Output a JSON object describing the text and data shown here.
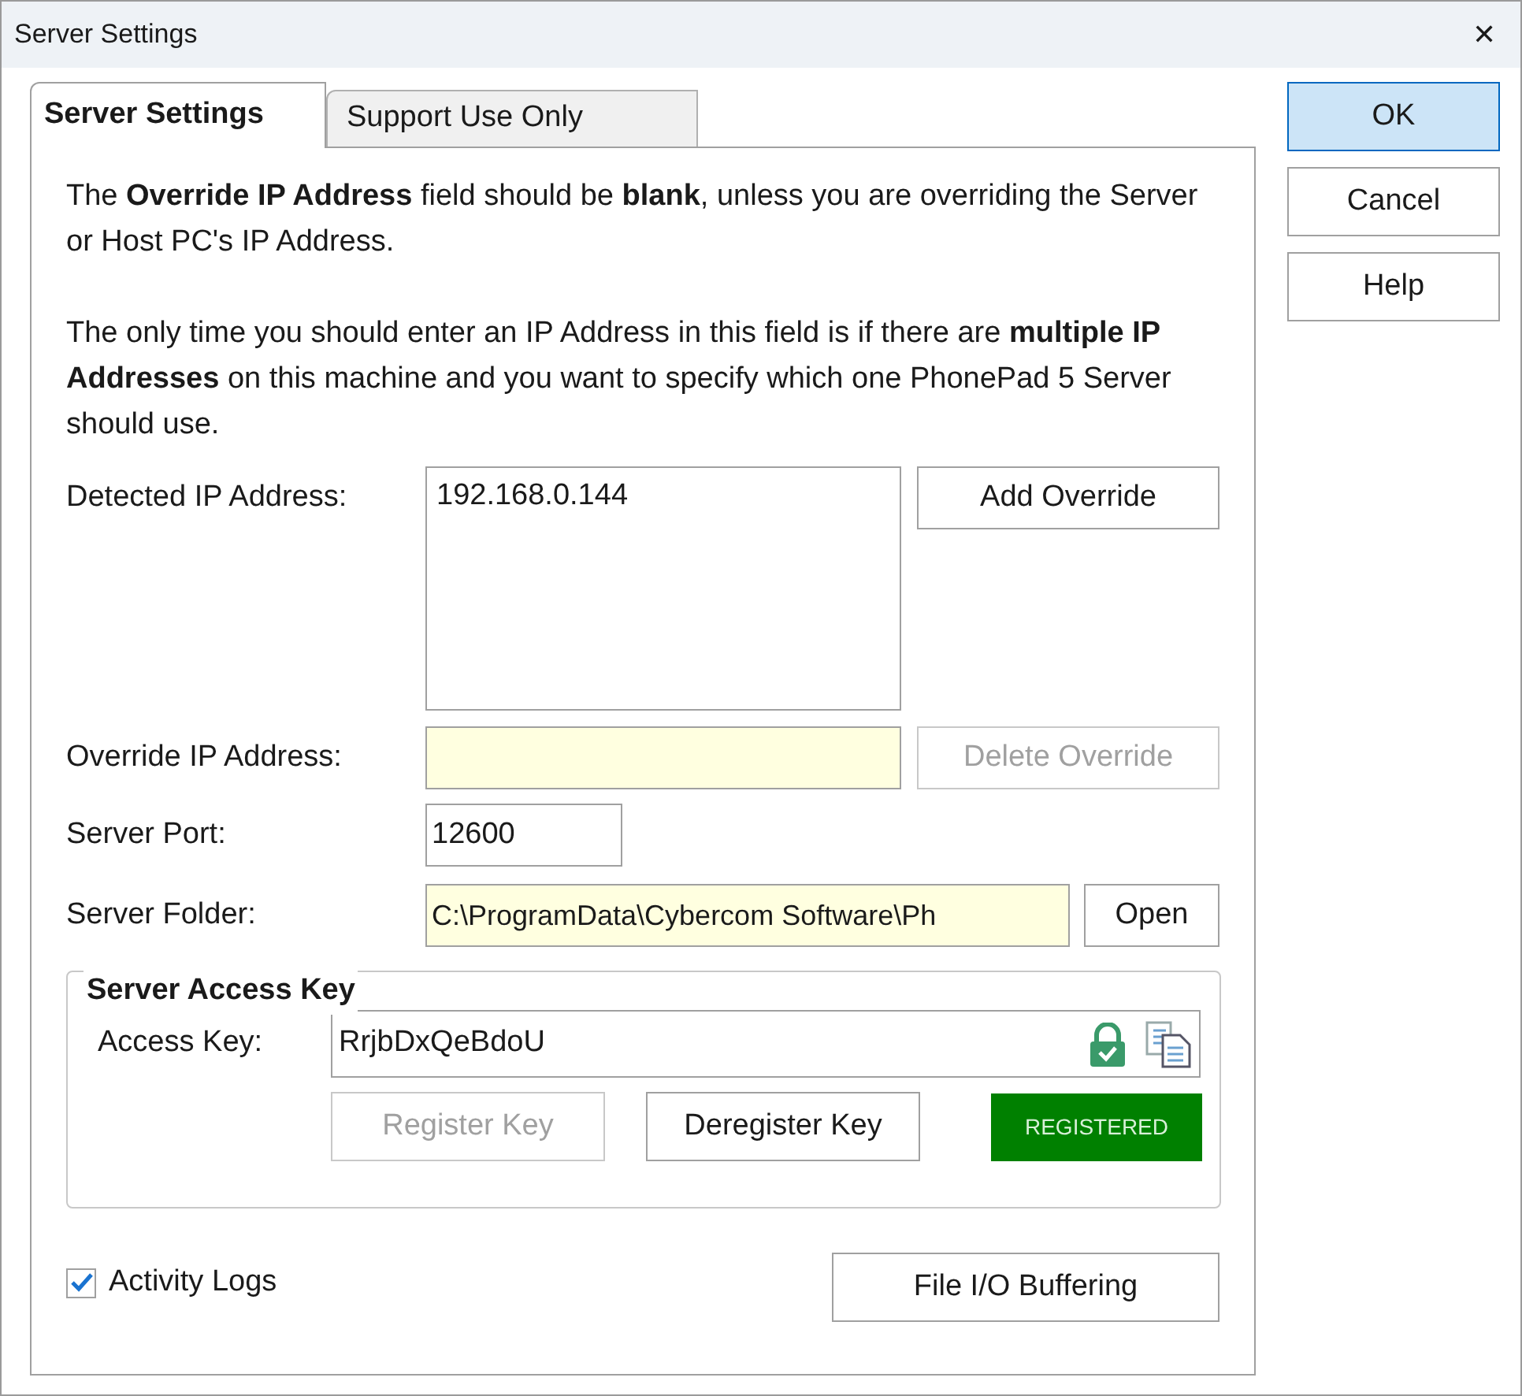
{
  "window": {
    "title": "Server Settings",
    "close": "✕"
  },
  "tabs": [
    {
      "label": "Server Settings",
      "selected": true
    },
    {
      "label": "Support Use Only",
      "selected": false
    }
  ],
  "intro": [
    "The **Override IP Address** field should be **blank**, unless you are overriding the Server or Host PC's IP Address.",
    "The only time you should enter an IP Address in this field is if there are **multiple IP Addresses** on this machine and you want to specify which one PhonePad 5 Server should use."
  ],
  "detected_ip": {
    "label": "Detected IP Address:",
    "items": [
      "192.168.0.144"
    ],
    "button": {
      "label": "Add Override",
      "disabled": false
    }
  },
  "override_ip": {
    "label": "Override IP Address:",
    "button": {
      "label": "Delete Override",
      "disabled": true
    }
  },
  "server_port": {
    "label": "Server Port:",
    "value": "12600"
  },
  "server_folder": {
    "label": "Server Folder:",
    "value": "C:\\ProgramData\\Cybercom Software\\Ph",
    "button": {
      "label": "Open",
      "disabled": false
    }
  },
  "access_key_group": {
    "title": "Server Access Key",
    "label": "Access Key:",
    "value": "RrjbDxQeBdoU",
    "locked": true,
    "buttons": [
      {
        "label": "Register Key",
        "disabled": true
      },
      {
        "label": "Deregister Key",
        "disabled": false
      }
    ],
    "status": {
      "label": "REGISTERED",
      "color": "#008000"
    }
  },
  "activity_logs": {
    "label": "Activity Logs",
    "checked": true
  },
  "buffering_button": {
    "label": "File I/O Buffering",
    "disabled": false
  },
  "buttons": [
    {
      "label": "OK",
      "default": true
    },
    {
      "label": "Cancel",
      "default": false
    },
    {
      "label": "Help",
      "default": false
    }
  ]
}
